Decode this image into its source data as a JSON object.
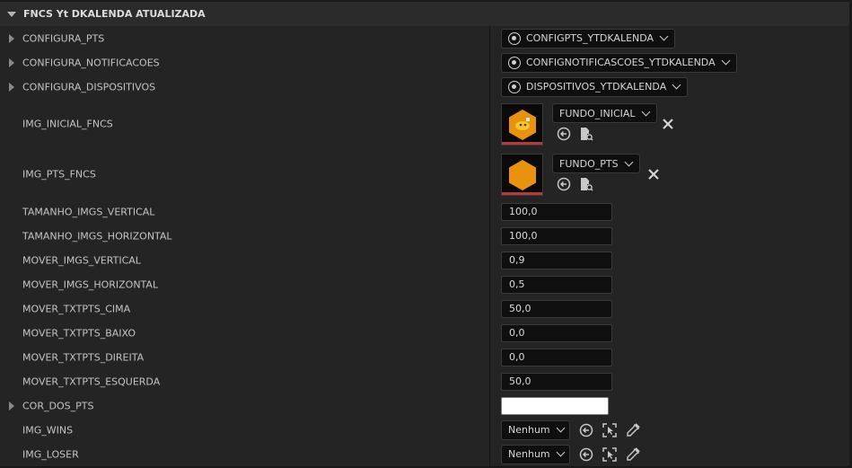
{
  "section": {
    "title": "FNCS Yt DKALENDA ATUALIZADA"
  },
  "rows": {
    "configura_pts": {
      "label": "CONFIGURA_PTS",
      "value": "CONFIGPTS_YTDKALENDA"
    },
    "configura_notificacoes": {
      "label": "CONFIGURA_NOTIFICACOES",
      "value": "CONFIGNOTIFICASCOES_YTDKALENDA"
    },
    "configura_dispositivos": {
      "label": "CONFIGURA_DISPOSITIVOS",
      "value": "DISPOSITIVOS_YTDKALENDA"
    },
    "img_inicial_fncs": {
      "label": "IMG_INICIAL_FNCS",
      "value": "FUNDO_INICIAL"
    },
    "img_pts_fncs": {
      "label": "IMG_PTS_FNCS",
      "value": "FUNDO_PTS"
    },
    "tamanho_imgs_vertical": {
      "label": "TAMANHO_IMGS_VERTICAL",
      "value": "100,0"
    },
    "tamanho_imgs_horizontal": {
      "label": "TAMANHO_IMGS_HORIZONTAL",
      "value": "100,0"
    },
    "mover_imgs_vertical": {
      "label": "MOVER_IMGS_VERTICAL",
      "value": "0,9"
    },
    "mover_imgs_horizontal": {
      "label": "MOVER_IMGS_HORIZONTAL",
      "value": "0,5"
    },
    "mover_txtpts_cima": {
      "label": "MOVER_TXTPTS_CIMA",
      "value": "50,0"
    },
    "mover_txtpts_baixo": {
      "label": "MOVER_TXTPTS_BAIXO",
      "value": "0,0"
    },
    "mover_txtpts_direita": {
      "label": "MOVER_TXTPTS_DIREITA",
      "value": "0,0"
    },
    "mover_txtpts_esquerda": {
      "label": "MOVER_TXTPTS_ESQUERDA",
      "value": "50,0"
    },
    "cor_dos_pts": {
      "label": "COR_DOS_PTS",
      "color": "#ffffff"
    },
    "img_wins": {
      "label": "IMG_WINS",
      "value": "Nenhum"
    },
    "img_loser": {
      "label": "IMG_LOSER",
      "value": "Nenhum"
    }
  },
  "colors": {
    "accent_orange": "#e8920e",
    "thumb_bar": "#b53a3a"
  },
  "icons": [
    "asset-icon",
    "chevron-down-icon",
    "use-selected-icon",
    "browse-icon",
    "close-icon",
    "pick-actor-icon",
    "eyedropper-icon"
  ]
}
